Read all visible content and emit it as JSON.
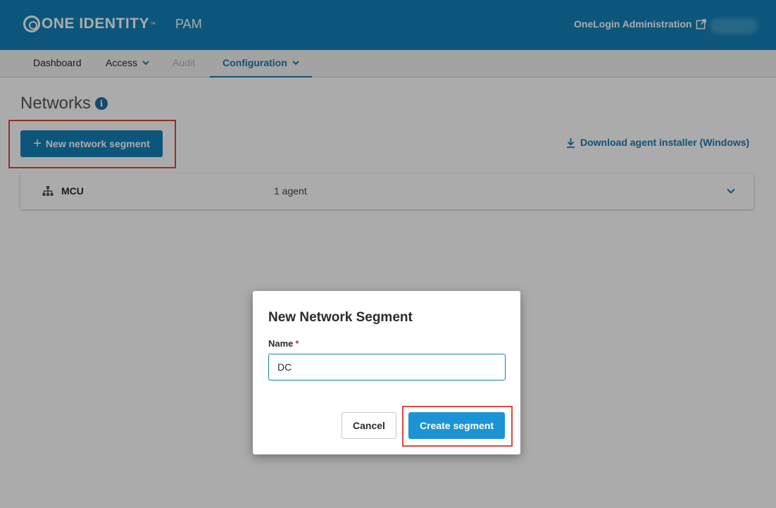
{
  "header": {
    "brand": "ONE IDENTITY",
    "brand_tm": "™",
    "product": "PAM",
    "admin_link": "OneLogin Administration",
    "icons": {
      "external": "external-link-icon",
      "logo": "one-identity-logo-icon"
    }
  },
  "nav": {
    "items": [
      {
        "label": "Dashboard"
      },
      {
        "label": "Access"
      },
      {
        "label": "Audit"
      },
      {
        "label": "Configuration"
      }
    ]
  },
  "page": {
    "title": "Networks",
    "new_segment_label": "New network segment",
    "download_label": "Download agent installer (Windows)"
  },
  "segments": [
    {
      "name": "MCU",
      "agents": "1 agent"
    }
  ],
  "modal": {
    "title": "New Network Segment",
    "name_label": "Name",
    "required_mark": "*",
    "name_value": "DC",
    "cancel_label": "Cancel",
    "create_label": "Create segment"
  },
  "colors": {
    "brand": "#1381b8",
    "primary_button": "#1c93d4",
    "highlight": "#e0473e"
  }
}
